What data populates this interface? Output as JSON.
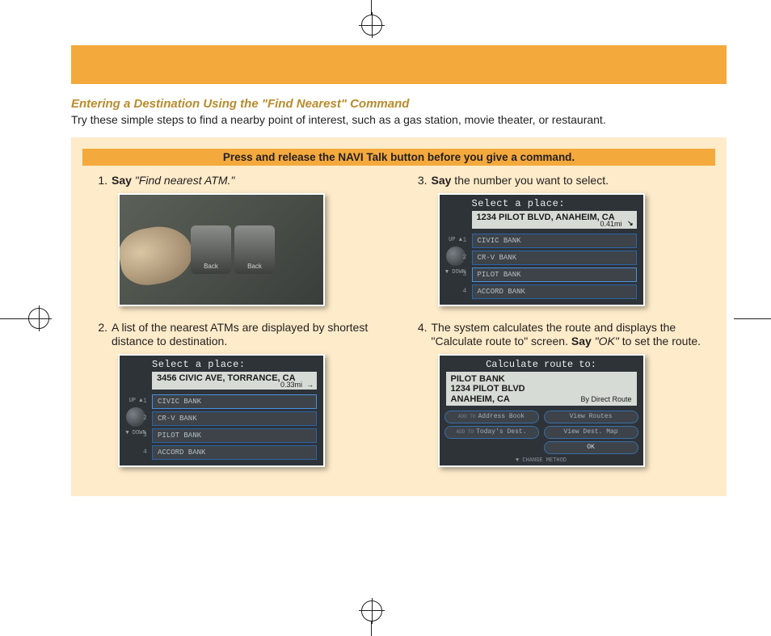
{
  "title": "Entering a Destination Using the \"Find Nearest\" Command",
  "intro": "Try these simple steps to find a nearby point of interest, such as a gas station, movie theater, or restaurant.",
  "panel": {
    "header": "Press and release the NAVI Talk button before you give a command."
  },
  "steps": {
    "s1": {
      "num": "1.",
      "say": "Say",
      "quote": " \"Find nearest ATM.\""
    },
    "s2": {
      "num": "2.",
      "body": "A list of the nearest ATMs are displayed by shortest distance to destination."
    },
    "s3": {
      "num": "3.",
      "say": "Say",
      "rest": " the number you want to select."
    },
    "s4": {
      "num": "4.",
      "lead": "The system calculates the route and displays the \"Calculate route to\" screen. ",
      "say": "Say",
      "quote": " \"OK\"",
      "tail": " to set the route."
    }
  },
  "photo1": {
    "btn_back_1": "Back",
    "btn_back_2": "Back"
  },
  "screen2": {
    "header": "Select a place:",
    "address": "3456 CIVIC AVE, TORRANCE, CA",
    "distance": "0.33mi",
    "arrow": "→",
    "up": "UP ▲",
    "down": "▼ DOWN",
    "rows": [
      {
        "idx": "1",
        "label": "CIVIC BANK"
      },
      {
        "idx": "2",
        "label": "CR-V BANK"
      },
      {
        "idx": "3",
        "label": "PILOT BANK"
      },
      {
        "idx": "4",
        "label": "ACCORD BANK"
      }
    ]
  },
  "screen3": {
    "header": "Select a place:",
    "address": "1234 PILOT BLVD, ANAHEIM, CA",
    "distance": "0.41mi",
    "arrow": "↘",
    "up": "UP ▲",
    "down": "▼ DOWN",
    "rows": [
      {
        "idx": "1",
        "label": "CIVIC BANK"
      },
      {
        "idx": "2",
        "label": "CR-V BANK"
      },
      {
        "idx": "3",
        "label": "PILOT BANK"
      },
      {
        "idx": "4",
        "label": "ACCORD BANK"
      }
    ]
  },
  "screen4": {
    "header": "Calculate route to:",
    "dest_name": "PILOT BANK",
    "dest_line1": "1234 PILOT BLVD",
    "dest_line2": "ANAHEIM, CA",
    "route": "By Direct Route",
    "btns": {
      "addr_pre": "ADD TO",
      "addr": "Address Book",
      "today_pre": "ADD TO",
      "today": "Today's Dest.",
      "view_routes": "View Routes",
      "view_map": "View Dest. Map",
      "ok": "OK"
    },
    "footer": "▼ CHANGE METHOD"
  }
}
